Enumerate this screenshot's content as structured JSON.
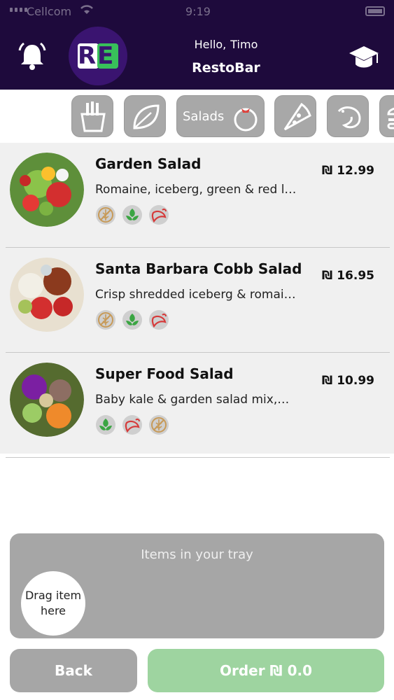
{
  "status_bar": {
    "carrier": "Cellcom",
    "time": "9:19"
  },
  "header": {
    "greeting_word": "Hello,",
    "user_name": "Timo",
    "restaurant_name": "RestoBar",
    "logo_text": "RE"
  },
  "categories": [
    {
      "icon": "fries-icon",
      "label": "",
      "selected": false
    },
    {
      "icon": "leaf-icon",
      "label": "",
      "selected": false
    },
    {
      "icon": "tomato-icon",
      "label": "Salads",
      "selected": true
    },
    {
      "icon": "pizza-icon",
      "label": "",
      "selected": false
    },
    {
      "icon": "shrimp-icon",
      "label": "",
      "selected": false
    },
    {
      "icon": "burger-icon",
      "label": "",
      "selected": false
    }
  ],
  "menu_items": [
    {
      "name": "Garden Salad",
      "description": "Romaine, iceberg, green & red l…",
      "price": "₪ 12.99",
      "tags": [
        "no-gluten-icon",
        "vegan-icon",
        "spicy-icon"
      ]
    },
    {
      "name": "Santa Barbara Cobb Salad",
      "description": "Crisp shredded iceberg & romai…",
      "price": "₪ 16.95",
      "tags": [
        "no-gluten-icon",
        "vegan-icon",
        "spicy-icon"
      ]
    },
    {
      "name": "Super Food Salad",
      "description": "Baby kale & garden salad mix,…",
      "price": "₪ 10.99",
      "tags": [
        "vegan-icon",
        "spicy-icon",
        "no-gluten-icon"
      ]
    }
  ],
  "tray": {
    "title": "Items in your tray",
    "drag_hint_line1": "Drag item",
    "drag_hint_line2": "here"
  },
  "buttons": {
    "back": "Back",
    "order": "Order ₪ 0.0"
  },
  "colors": {
    "header_bg": "#1e0a3c",
    "accent_green": "#38c05a",
    "logo_purple": "#3a1470",
    "order_button": "#9ed4a0",
    "gray": "#a6a6a6"
  }
}
